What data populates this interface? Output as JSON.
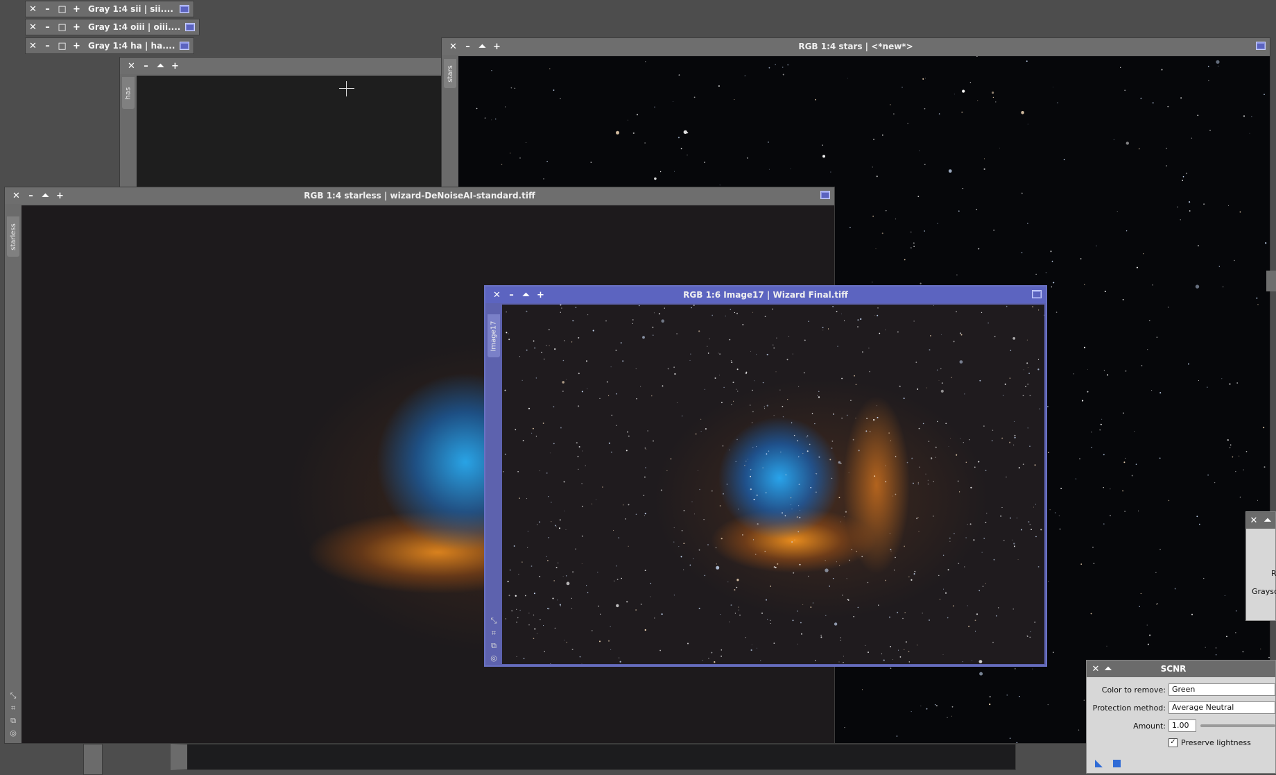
{
  "mini_windows": [
    {
      "title": "Gray 1:4 sii | sii...."
    },
    {
      "title": "Gray 1:4 oiii | oiii...."
    },
    {
      "title": "Gray 1:4 ha | ha...."
    }
  ],
  "ha_window": {
    "tab": "has"
  },
  "stars_window": {
    "title": "RGB 1:4 stars | <*new*>",
    "tab": "stars"
  },
  "starless_window": {
    "title": "RGB 1:4 starless | wizard-DeNoiseAI-standard.tiff",
    "tab": "starless"
  },
  "image17_window": {
    "title": "RGB 1:6 Image17 | Wizard Final.tiff",
    "tab": "Image17"
  },
  "partial_panel": {
    "label_r": "R",
    "label_gray": "Graysc"
  },
  "scnr": {
    "title": "SCNR",
    "color_label": "Color to remove:",
    "color_value": "Green",
    "protection_label": "Protection method:",
    "protection_value": "Average Neutral",
    "amount_label": "Amount:",
    "amount_value": "1.00",
    "preserve_label": "Preserve lightness",
    "preserve_checked": "✓"
  },
  "icons": {
    "close": "✕",
    "minimize": "–",
    "shade": "⏶",
    "iconize": "□",
    "add": "+"
  },
  "colors": {
    "active_title": "#5c64c0",
    "inactive_title": "#6e6e6e",
    "nebula_blue": "#1aa6f0",
    "nebula_orange": "#e8891f"
  }
}
